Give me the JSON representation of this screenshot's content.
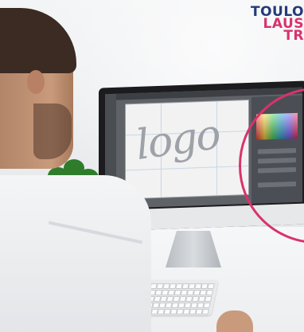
{
  "brand": {
    "line1": "TOULO",
    "line2": "LAUS",
    "line3": "TR"
  },
  "screen": {
    "logo_word": "logo"
  },
  "colors": {
    "accent_pink": "#d8336b",
    "accent_navy": "#243b78"
  }
}
